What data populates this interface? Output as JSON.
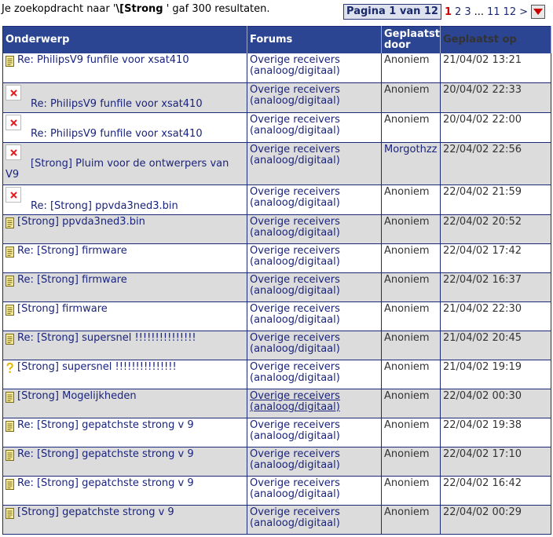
{
  "search": {
    "prefix": "Je zoekopdracht naar '",
    "query": "\\[Strong",
    "suffix": " ' gaf 300 resultaten."
  },
  "pager": {
    "label": "Pagina 1 van 12",
    "current": "1",
    "pages": [
      "2",
      "3"
    ],
    "ellipsis": "...",
    "last_pages": [
      "11",
      "12"
    ],
    "next": ">"
  },
  "table": {
    "headers": {
      "subject": "Onderwerp",
      "forums": "Forums",
      "posted_by": "Geplaatst door",
      "posted_on": "Geplaatst op"
    },
    "rows": [
      {
        "icon": "doc",
        "subject": "Re: PhilipsV9 funfile voor xsat410",
        "forum": "Overige receivers (analoog/digitaal)",
        "author": "Anoniem",
        "date": "21/04/02 13:21"
      },
      {
        "icon": "broken",
        "subject": "Re: PhilipsV9 funfile voor xsat410",
        "forum": "Overige receivers (analoog/digitaal)",
        "author": "Anoniem",
        "date": "20/04/02 22:33"
      },
      {
        "icon": "broken",
        "subject": "Re: PhilipsV9 funfile voor xsat410",
        "forum": "Overige receivers (analoog/digitaal)",
        "author": "Anoniem",
        "date": "20/04/02 22:00"
      },
      {
        "icon": "broken",
        "subject": "[Strong] Pluim voor de ontwerpers van V9",
        "forum": "Overige receivers (analoog/digitaal)",
        "author": "Morgothzz",
        "date": "22/04/02 22:56"
      },
      {
        "icon": "broken",
        "subject": "Re: [Strong] ppvda3ned3.bin",
        "forum": "Overige receivers (analoog/digitaal)",
        "author": "Anoniem",
        "date": "22/04/02 21:59"
      },
      {
        "icon": "doc",
        "subject": "[Strong] ppvda3ned3.bin",
        "forum": "Overige receivers (analoog/digitaal)",
        "author": "Anoniem",
        "date": "22/04/02 20:52"
      },
      {
        "icon": "doc",
        "subject": "Re: [Strong] firmware",
        "forum": "Overige receivers (analoog/digitaal)",
        "author": "Anoniem",
        "date": "22/04/02 17:42"
      },
      {
        "icon": "doc",
        "subject": "Re: [Strong] firmware",
        "forum": "Overige receivers (analoog/digitaal)",
        "author": "Anoniem",
        "date": "22/04/02 16:37"
      },
      {
        "icon": "doc",
        "subject": "[Strong] firmware",
        "forum": "Overige receivers (analoog/digitaal)",
        "author": "Anoniem",
        "date": "21/04/02 22:30"
      },
      {
        "icon": "doc",
        "subject": "Re: [Strong] supersnel !!!!!!!!!!!!!!!",
        "forum": "Overige receivers (analoog/digitaal)",
        "author": "Anoniem",
        "date": "21/04/02 20:45"
      },
      {
        "icon": "question",
        "subject": "[Strong] supersnel !!!!!!!!!!!!!!!",
        "forum": "Overige receivers (analoog/digitaal)",
        "author": "Anoniem",
        "date": "21/04/02 19:19"
      },
      {
        "icon": "doc",
        "subject": "[Strong] Mogelijkheden",
        "forum": "Overige receivers (analoog/digitaal)",
        "author": "Anoniem",
        "date": "22/04/02 00:30"
      },
      {
        "icon": "doc",
        "subject": "Re: [Strong] gepatchste strong v 9",
        "forum": "Overige receivers (analoog/digitaal)",
        "author": "Anoniem",
        "date": "22/04/02 19:38"
      },
      {
        "icon": "doc",
        "subject": "Re: [Strong] gepatchste strong v 9",
        "forum": "Overige receivers (analoog/digitaal)",
        "author": "Anoniem",
        "date": "22/04/02 17:10"
      },
      {
        "icon": "doc",
        "subject": "Re: [Strong] gepatchste strong v 9",
        "forum": "Overige receivers (analoog/digitaal)",
        "author": "Anoniem",
        "date": "22/04/02 16:42"
      },
      {
        "icon": "doc",
        "subject": "[Strong] gepatchste strong v 9",
        "forum": "Overige receivers (analoog/digitaal)",
        "author": "Anoniem",
        "date": "22/04/02 00:29"
      }
    ]
  },
  "colors": {
    "header_bg": "#2b4593",
    "link": "#1a237e",
    "row_alt": "#dcdcdc",
    "current_page": "#cc0000"
  }
}
